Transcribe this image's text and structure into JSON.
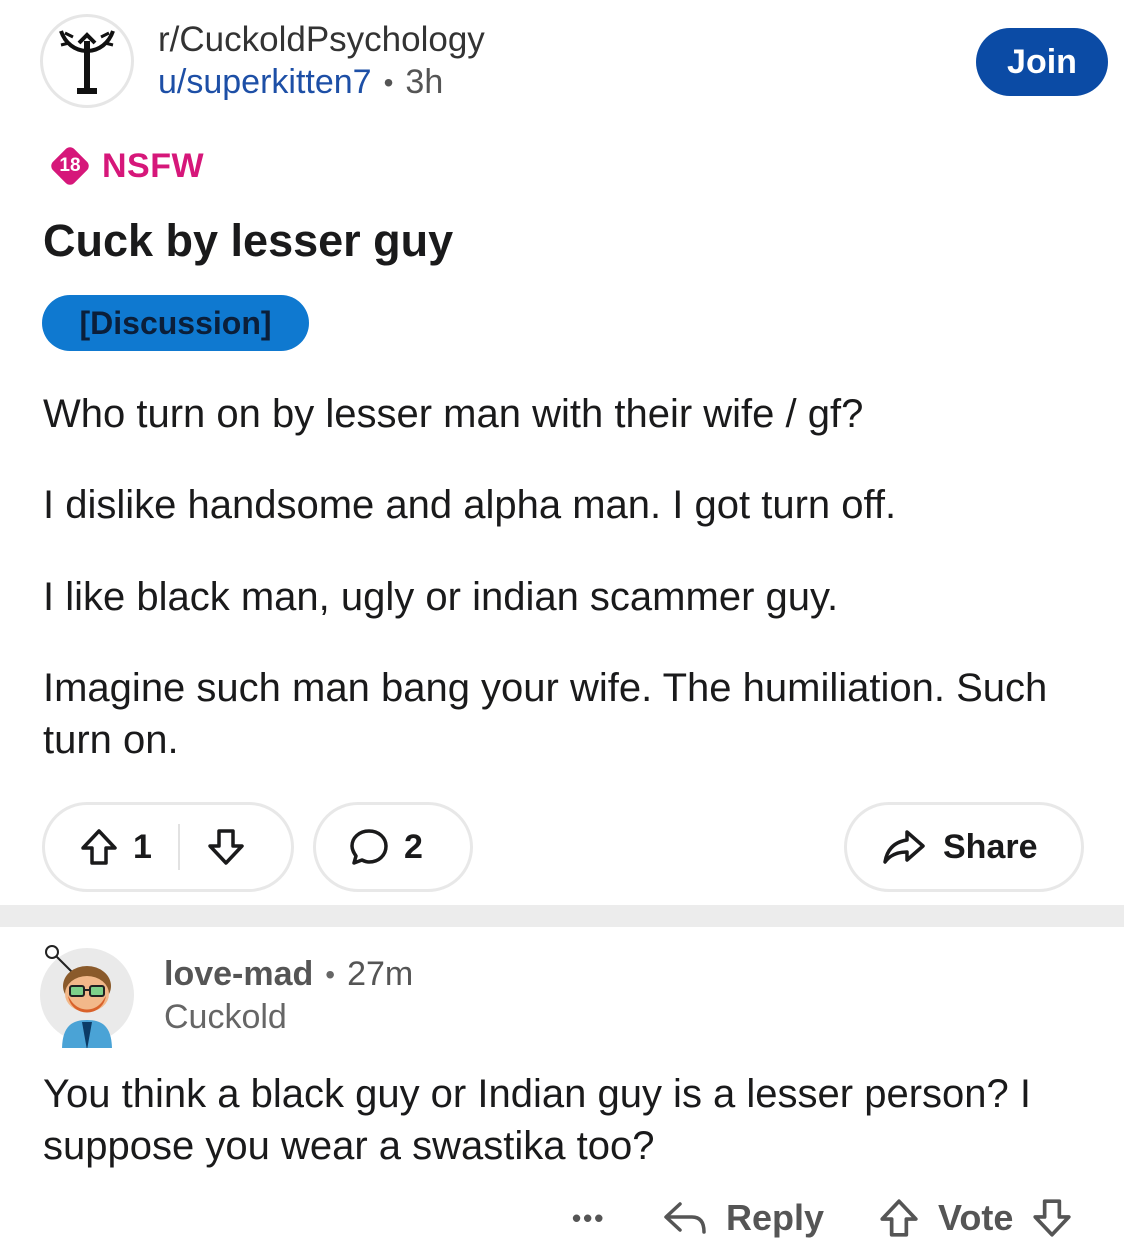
{
  "post": {
    "subreddit": "r/CuckoldPsychology",
    "author": "u/superkitten7",
    "separator": "•",
    "age": "3h",
    "join_label": "Join",
    "nsfw_badge": "18",
    "nsfw_label": "NSFW",
    "title": "Cuck by lesser guy",
    "flair": "[Discussion]",
    "paragraphs": [
      "Who turn on by lesser man with their wife / gf?",
      "I dislike handsome and alpha man. I got turn off.",
      "I like black man, ugly or indian scammer guy.",
      "Imagine such man bang your wife. The humiliation. Such turn on."
    ],
    "vote_count": "1",
    "comment_count": "2",
    "share_label": "Share"
  },
  "comment": {
    "username": "love-mad",
    "separator": "•",
    "age": "27m",
    "user_flair": "Cuckold",
    "text": "You think a black guy or Indian guy is a lesser person? I suppose you wear a swastika too?",
    "more_label": "•••",
    "reply_label": "Reply",
    "vote_label": "Vote"
  },
  "colors": {
    "join_bg": "#0b4ba5",
    "nsfw": "#d6177a",
    "flair_bg": "#0f79d0",
    "link_blue": "#1d4fa6"
  },
  "icons": [
    "subreddit-avatar-icon",
    "nsfw-badge-icon",
    "upvote-icon",
    "downvote-icon",
    "comment-icon",
    "share-icon",
    "user-avatar-icon",
    "more-icon",
    "reply-icon"
  ]
}
